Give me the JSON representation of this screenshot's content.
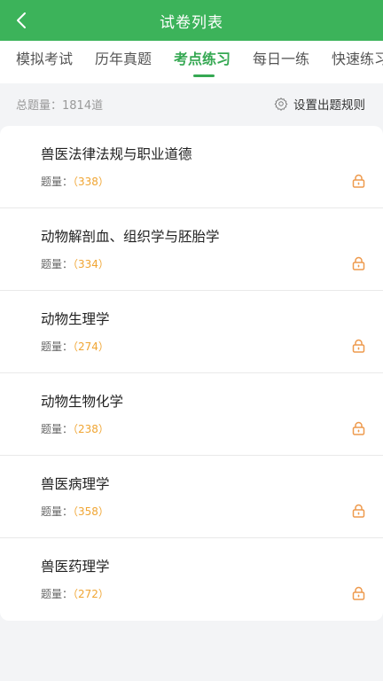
{
  "header": {
    "title": "试卷列表",
    "back_icon": "chevron-left-icon"
  },
  "tabs": [
    {
      "label": "模拟考试",
      "active": false
    },
    {
      "label": "历年真题",
      "active": false
    },
    {
      "label": "考点练习",
      "active": true
    },
    {
      "label": "每日一练",
      "active": false
    },
    {
      "label": "快速练习",
      "active": false
    }
  ],
  "stats": {
    "total_label": "总题量：1814道",
    "rules_label": "设置出题规则",
    "rules_icon": "gear-icon"
  },
  "meta_label": "题量：",
  "items": [
    {
      "title": "兽医法律法规与职业道德",
      "count": "（338）",
      "locked": true
    },
    {
      "title": "动物解剖血、组织学与胚胎学",
      "count": "（334）",
      "locked": true
    },
    {
      "title": "动物生理学",
      "count": "（274）",
      "locked": true
    },
    {
      "title": "动物生物化学",
      "count": "（238）",
      "locked": true
    },
    {
      "title": "兽医病理学",
      "count": "（358）",
      "locked": true
    },
    {
      "title": "兽医药理学",
      "count": "（272）",
      "locked": true
    }
  ],
  "colors": {
    "primary": "#3cb35a",
    "accent_text": "#35a852",
    "count": "#f0a533",
    "lock": "#ee9a4d"
  }
}
